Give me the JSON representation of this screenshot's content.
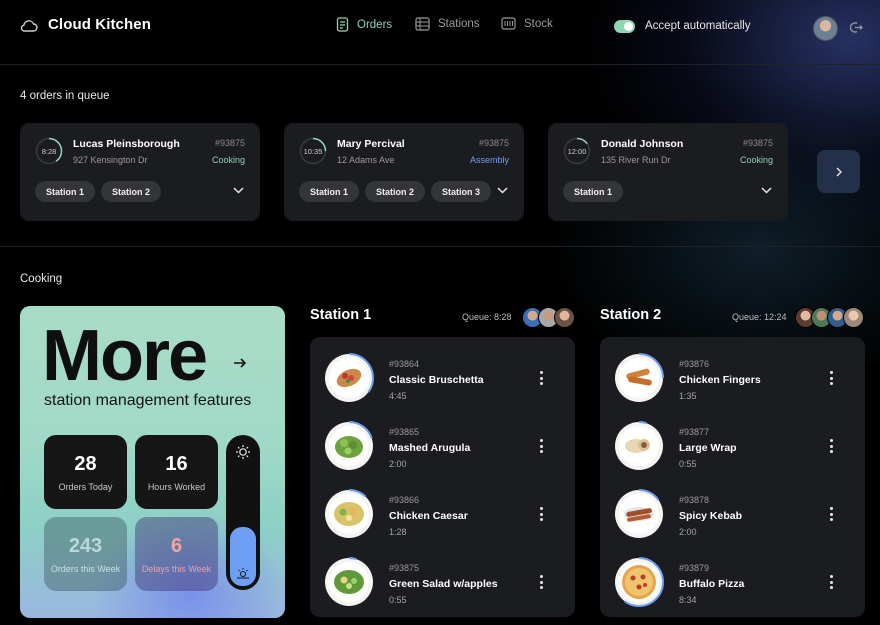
{
  "app": {
    "name": "Cloud Kitchen"
  },
  "nav": {
    "orders": "Orders",
    "stations": "Stations",
    "stock": "Stock"
  },
  "header": {
    "accept_label": "Accept automatically",
    "accept_on": true
  },
  "queue": {
    "title": "4 orders in queue",
    "orders": [
      {
        "time": "8:28",
        "name": "Lucas Pleinsborough",
        "address": "927 Kensington Dr",
        "id": "#93875",
        "status": "Cooking",
        "status_color": "#8fd6b4",
        "stations": [
          "Station 1",
          "Station 2"
        ],
        "progress": 0.4
      },
      {
        "time": "10:35",
        "name": "Mary Percival",
        "address": "12 Adams Ave",
        "id": "#93875",
        "status": "Assembly",
        "status_color": "#6f9ff2",
        "stations": [
          "Station 1",
          "Station 2",
          "Station 3"
        ],
        "progress": 0.25
      },
      {
        "time": "12:00",
        "name": "Donald Johnson",
        "address": "135 River Run Dr",
        "id": "#93875",
        "status": "Cooking",
        "status_color": "#8fd6b4",
        "stations": [
          "Station 1"
        ],
        "progress": 0.15
      }
    ]
  },
  "cooking": {
    "title": "Cooking"
  },
  "promo": {
    "headline": "More",
    "subline": "station management features",
    "stats": [
      {
        "value": "28",
        "label": "Orders Today"
      },
      {
        "value": "16",
        "label": "Hours Worked"
      },
      {
        "value": "243",
        "label": "Orders this Week"
      },
      {
        "value": "6",
        "label": "Delays this Week"
      }
    ],
    "brightness_level": 0.4
  },
  "stations": [
    {
      "name": "Station 1",
      "queue": "Queue: 8:28",
      "items": [
        {
          "id": "#93864",
          "name": "Classic Bruschetta",
          "time": "4:45",
          "dish": "bruschetta"
        },
        {
          "id": "#93865",
          "name": "Mashed Arugula",
          "time": "2:00",
          "dish": "arugula"
        },
        {
          "id": "#93866",
          "name": "Chicken Caesar",
          "time": "1:28",
          "dish": "caesar"
        },
        {
          "id": "#93875",
          "name": "Green Salad w/apples",
          "time": "0:55",
          "dish": "salad"
        }
      ]
    },
    {
      "name": "Station 2",
      "queue": "Queue: 12:24",
      "items": [
        {
          "id": "#93876",
          "name": "Chicken Fingers",
          "time": "1:35",
          "dish": "fingers"
        },
        {
          "id": "#93877",
          "name": "Large Wrap",
          "time": "0:55",
          "dish": "wrap"
        },
        {
          "id": "#93878",
          "name": "Spicy Kebab",
          "time": "2:00",
          "dish": "kebab"
        },
        {
          "id": "#93879",
          "name": "Buffalo Pizza",
          "time": "8:34",
          "dish": "pizza"
        }
      ]
    }
  ]
}
